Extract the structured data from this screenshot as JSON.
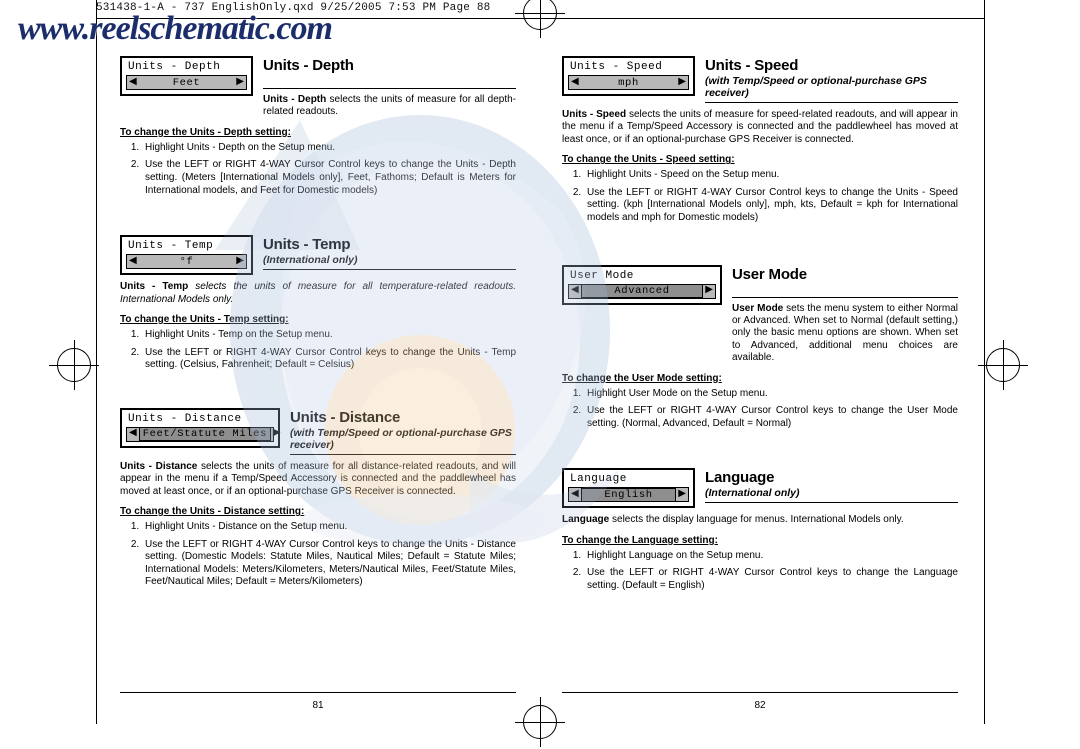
{
  "slug": {
    "text": "531438-1-A - 737 EnglishOnly.qxd   9/25/2005  7:53 PM   Page 88"
  },
  "watermark": {
    "text": "www.reelschematic.com"
  },
  "left_page": {
    "folio": "81",
    "sections": [
      {
        "lcd_title": "Units - Depth",
        "lcd_value": "Feet",
        "heading": "Units - Depth",
        "subheading": "",
        "intro_pre": "Units - Depth",
        "intro_rest": " selects the units of measure for all depth-related readouts.",
        "howto": "To change the Units - Depth setting:",
        "steps": [
          "Highlight Units - Depth on the Setup menu.",
          "Use the LEFT or RIGHT 4-WAY Cursor Control keys to change the Units - Depth setting. (Meters [International Models only], Feet, Fathoms; Default is Meters for International models, and Feet for Domestic models)"
        ]
      },
      {
        "lcd_title": "Units - Temp",
        "lcd_value": "°f",
        "heading": "Units - Temp",
        "subheading": "(International only)",
        "intro_pre": "Units - Temp",
        "intro_rest": " selects the units of measure for all temperature-related readouts.  International Models only.",
        "howto": "To change the Units - Temp setting:",
        "steps": [
          "Highlight Units - Temp on the Setup menu.",
          "Use the LEFT or RIGHT 4-WAY Cursor Control keys to change the Units - Temp setting. (Celsius, Fahrenheit; Default = Celsius)"
        ]
      },
      {
        "lcd_title": "Units - Distance",
        "lcd_value": "Feet/Statute Miles",
        "heading": "Units - Distance",
        "subheading": "(with Temp/Speed or optional-purchase GPS receiver)",
        "intro_pre": "Units - Distance",
        "intro_rest": " selects the units of measure for all distance-related readouts, and will appear in the menu if a Temp/Speed Accessory is connected and the paddlewheel has moved at least once, or if an optional-purchase GPS Receiver is connected.",
        "howto": "To change the Units - Distance setting:",
        "steps": [
          "Highlight Units - Distance on the Setup menu.",
          "Use the LEFT or RIGHT 4-WAY Cursor Control keys to change the Units - Distance setting. (Domestic Models: Statute Miles, Nautical Miles; Default = Statute Miles; International Models: Meters/Kilometers, Meters/Nautical Miles, Feet/Statute Miles, Feet/Nautical Miles; Default = Meters/Kilometers)"
        ]
      }
    ]
  },
  "right_page": {
    "folio": "82",
    "sections": [
      {
        "lcd_title": "Units - Speed",
        "lcd_value": "mph",
        "heading": "Units - Speed",
        "subheading": "(with Temp/Speed or optional-purchase GPS receiver)",
        "intro_pre": "Units - Speed",
        "intro_rest": " selects the units of measure for speed-related readouts, and will appear in the menu if a Temp/Speed Accessory is connected and the paddlewheel has moved at least once, or if an optional-purchase GPS Receiver is connected.",
        "howto": "To change the Units - Speed setting:",
        "steps": [
          "Highlight Units - Speed on the Setup menu.",
          "Use the LEFT or RIGHT 4-WAY Cursor Control keys to change the Units - Speed setting. (kph [International Models only], mph, kts, Default = kph for International models and mph for Domestic models)"
        ]
      },
      {
        "lcd_title": "User Mode",
        "lcd_value": "Advanced",
        "heading": "User Mode",
        "subheading": "",
        "intro_pre": "User Mode",
        "intro_rest": " sets the menu system to either Normal or Advanced. When set to Normal (default setting,) only the basic menu options are shown. When set to Advanced, additional menu choices are available.",
        "howto": "To change the User Mode setting:",
        "steps": [
          "Highlight User Mode on the Setup menu.",
          "Use the LEFT or RIGHT 4-WAY Cursor Control keys to change the User Mode setting. (Normal, Advanced, Default = Normal)"
        ]
      },
      {
        "lcd_title": "Language",
        "lcd_value": "English",
        "heading": "Language",
        "subheading": "(International only)",
        "intro_pre": "Language",
        "intro_rest": " selects the display language for menus. International Models only.",
        "howto": "To change the Language setting:",
        "steps": [
          "Highlight Language on the Setup menu.",
          "Use the LEFT or RIGHT 4-WAY Cursor Control keys to change the Language setting. (Default = English)"
        ]
      }
    ]
  },
  "icons": {
    "left_arrow": "◀",
    "right_arrow": "▶"
  }
}
